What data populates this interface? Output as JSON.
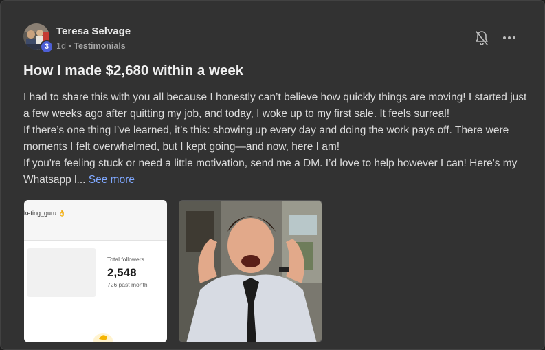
{
  "post": {
    "author": {
      "name": "Teresa Selvage",
      "level": "3"
    },
    "meta": {
      "time": "1d",
      "separator": "•",
      "category": "Testimonials"
    },
    "title": "How I made $2,680 within a week",
    "body": {
      "paragraph1": "I had to share this with you all because I honestly can’t believe how quickly things are moving! I started just a few weeks ago after quitting my job, and today, I woke up to my first sale. It feels surreal!",
      "paragraph2": "If there’s one thing I’ve learned, it’s this: showing up every day and doing the work pays off. There were moments I felt overwhelmed, but I kept going—and now, here I am!",
      "paragraph3": "If you're feeling stuck or need a little motivation, send me a DM. I’d love to help however I can! Here's my Whatsapp l...",
      "see_more": "See more"
    },
    "attachments": {
      "stats_screenshot": {
        "handle": "keting_guru 👌",
        "label": "Total followers",
        "value": "2,548",
        "subtext": "726 past month"
      }
    },
    "icons": {
      "bell": "bell-off-icon",
      "more": "more-horizontal-icon"
    }
  },
  "colors": {
    "card_bg": "#323232",
    "link": "#7fa8ff",
    "level_badge": "#4d5fd6"
  }
}
